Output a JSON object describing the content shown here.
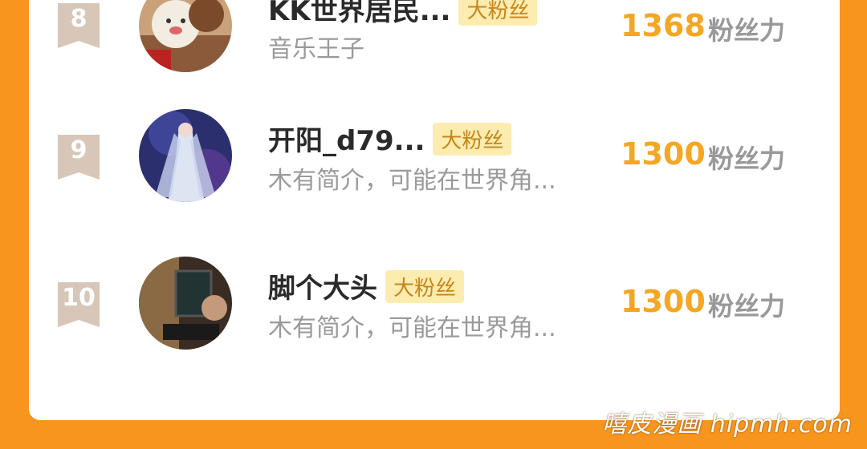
{
  "leaderboard": {
    "rows": [
      {
        "rank": "8",
        "name": "KK世界居民...",
        "badge": "大粉丝",
        "bio": "音乐王子",
        "score": "1368",
        "unit": "粉丝力"
      },
      {
        "rank": "9",
        "name": "开阳_d79...",
        "badge": "大粉丝",
        "bio": "木有简介，可能在世界角...",
        "score": "1300",
        "unit": "粉丝力"
      },
      {
        "rank": "10",
        "name": "脚个大头",
        "badge": "大粉丝",
        "bio": "木有简介，可能在世界角...",
        "score": "1300",
        "unit": "粉丝力"
      }
    ]
  },
  "watermark": "嘻皮漫画 hipmh.com",
  "colors": {
    "background": "#f7951f",
    "score": "#f5a623",
    "badge_bg": "#fdecb0",
    "rank_ribbon": "#d8c7b8"
  }
}
